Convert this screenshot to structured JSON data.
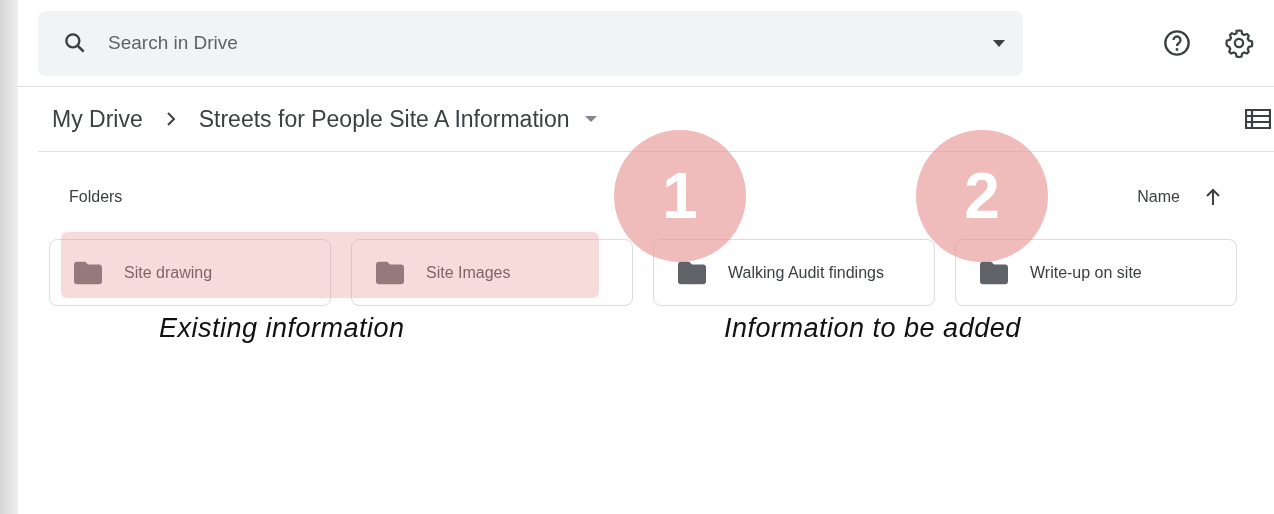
{
  "search": {
    "placeholder": "Search in Drive"
  },
  "breadcrumb": [
    {
      "label": "My Drive"
    },
    {
      "label": "Streets for People Site A Information"
    }
  ],
  "section_label": "Folders",
  "sort": {
    "label": "Name"
  },
  "folders": [
    {
      "name": "Site drawing",
      "highlighted": true
    },
    {
      "name": "Site Images",
      "highlighted": true
    },
    {
      "name": "Walking Audit findings",
      "highlighted": false,
      "marker": "1"
    },
    {
      "name": "Write-up on site",
      "highlighted": false,
      "marker": "2"
    }
  ],
  "captions": [
    "Existing information",
    "Information to be added"
  ]
}
